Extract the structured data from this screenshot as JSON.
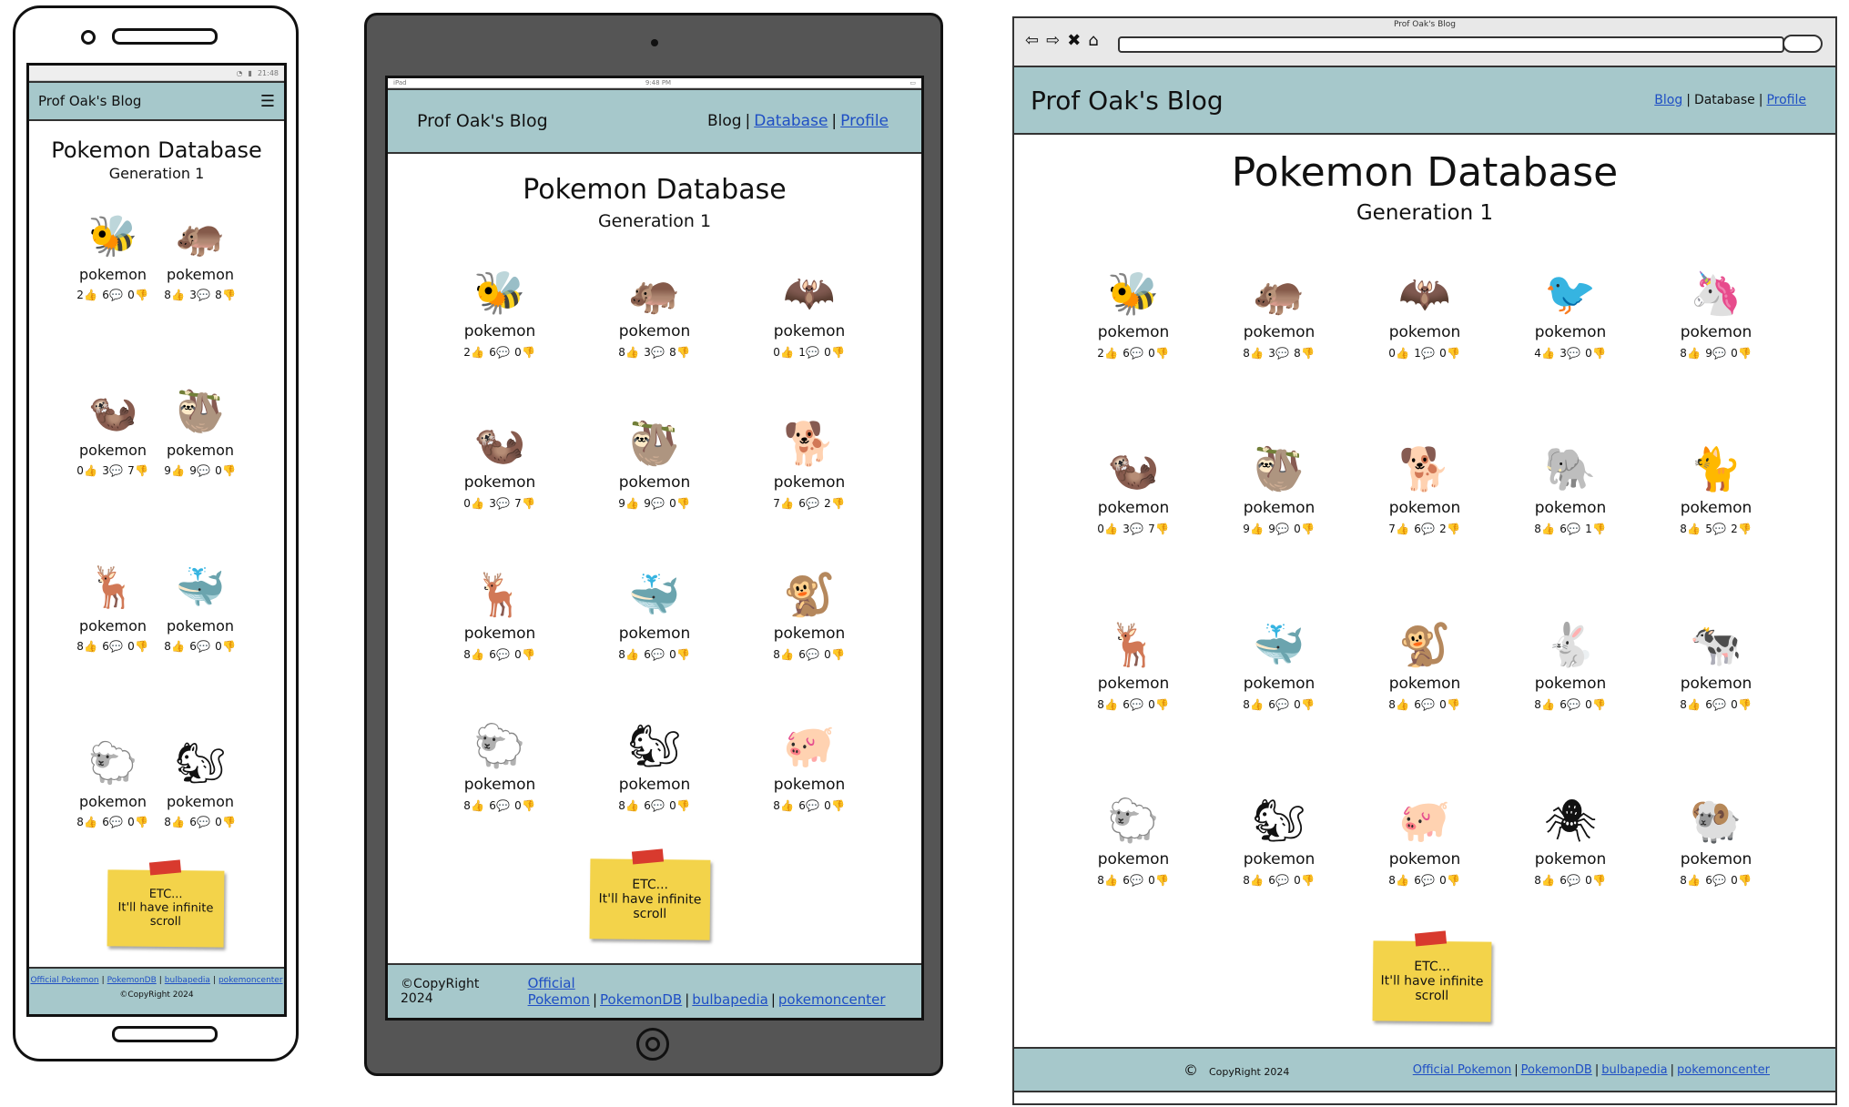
{
  "blog_title": "Prof Oak's Blog",
  "page_title": "Pokemon Database",
  "page_subtitle": "Generation 1",
  "nav": {
    "blog": "Blog",
    "database": "Database",
    "profile": "Profile"
  },
  "note": {
    "line1": "ETC...",
    "line2": "It'll have infinite scroll"
  },
  "footer": {
    "copyright": "CopyRight 2024",
    "copyright_symbol": "©",
    "links": [
      "Official Pokemon",
      "PokemonDB",
      "bulbapedia",
      "pokemoncenter"
    ]
  },
  "phone": {
    "status_time": "21:48"
  },
  "tablet": {
    "status_left": "iPad",
    "status_time": "9:48 PM"
  },
  "browser": {
    "window_title": "Prof Oak's Blog"
  },
  "icons": {
    "like": "thumbs-up-icon",
    "comment": "comment-icon",
    "dislike": "thumbs-down-icon"
  },
  "colors": {
    "header_bg": "#a6c8cb",
    "link": "#1f4fc4",
    "note": "#f3d34a",
    "tape": "#d83a2e"
  },
  "pokemon": [
    {
      "name": "pokemon",
      "icon": "bee-icon",
      "glyph": "🐝",
      "likes": "2",
      "comments": "6",
      "dislikes": "0"
    },
    {
      "name": "pokemon",
      "icon": "hippo-icon",
      "glyph": "🦛",
      "likes": "8",
      "comments": "3",
      "dislikes": "8"
    },
    {
      "name": "pokemon",
      "icon": "bat-icon",
      "glyph": "🦇",
      "likes": "0",
      "comments": "1",
      "dislikes": "0"
    },
    {
      "name": "pokemon",
      "icon": "bird-icon",
      "glyph": "🐦",
      "likes": "4",
      "comments": "3",
      "dislikes": "0"
    },
    {
      "name": "pokemon",
      "icon": "unicorn-icon",
      "glyph": "🦄",
      "likes": "8",
      "comments": "9",
      "dislikes": "0"
    },
    {
      "name": "pokemon",
      "icon": "otter-icon",
      "glyph": "🦦",
      "likes": "0",
      "comments": "3",
      "dislikes": "7"
    },
    {
      "name": "pokemon",
      "icon": "sloth-icon",
      "glyph": "🦥",
      "likes": "9",
      "comments": "9",
      "dislikes": "0"
    },
    {
      "name": "pokemon",
      "icon": "dog-icon",
      "glyph": "🐕",
      "likes": "7",
      "comments": "6",
      "dislikes": "2"
    },
    {
      "name": "pokemon",
      "icon": "elephant-icon",
      "glyph": "🐘",
      "likes": "8",
      "comments": "6",
      "dislikes": "1"
    },
    {
      "name": "pokemon",
      "icon": "cat-icon",
      "glyph": "🐈",
      "likes": "8",
      "comments": "5",
      "dislikes": "2"
    },
    {
      "name": "pokemon",
      "icon": "deer-icon",
      "glyph": "🦌",
      "likes": "8",
      "comments": "6",
      "dislikes": "0"
    },
    {
      "name": "pokemon",
      "icon": "narwhal-icon",
      "glyph": "🐳",
      "likes": "8",
      "comments": "6",
      "dislikes": "0"
    },
    {
      "name": "pokemon",
      "icon": "monkey-icon",
      "glyph": "🐒",
      "likes": "8",
      "comments": "6",
      "dislikes": "0"
    },
    {
      "name": "pokemon",
      "icon": "rabbit-icon",
      "glyph": "🐇",
      "likes": "8",
      "comments": "6",
      "dislikes": "0"
    },
    {
      "name": "pokemon",
      "icon": "cow-icon",
      "glyph": "🐄",
      "likes": "8",
      "comments": "6",
      "dislikes": "0"
    },
    {
      "name": "pokemon",
      "icon": "sheep-icon",
      "glyph": "🐑",
      "likes": "8",
      "comments": "6",
      "dislikes": "0"
    },
    {
      "name": "pokemon",
      "icon": "squirrel-icon",
      "glyph": "🐿",
      "likes": "8",
      "comments": "6",
      "dislikes": "0"
    },
    {
      "name": "pokemon",
      "icon": "pig-icon",
      "glyph": "🐖",
      "likes": "8",
      "comments": "6",
      "dislikes": "0"
    },
    {
      "name": "pokemon",
      "icon": "spider-icon",
      "glyph": "🕷",
      "likes": "8",
      "comments": "6",
      "dislikes": "0"
    },
    {
      "name": "pokemon",
      "icon": "ram-icon",
      "glyph": "🐏",
      "likes": "8",
      "comments": "6",
      "dislikes": "0"
    }
  ],
  "layouts": {
    "phone": [
      0,
      1,
      5,
      6,
      10,
      11,
      15,
      16
    ],
    "tablet": [
      0,
      1,
      2,
      5,
      6,
      7,
      10,
      11,
      12,
      15,
      16,
      17
    ],
    "browser": [
      0,
      1,
      2,
      3,
      4,
      5,
      6,
      7,
      8,
      9,
      10,
      11,
      12,
      13,
      14,
      15,
      16,
      17,
      18,
      19
    ]
  }
}
